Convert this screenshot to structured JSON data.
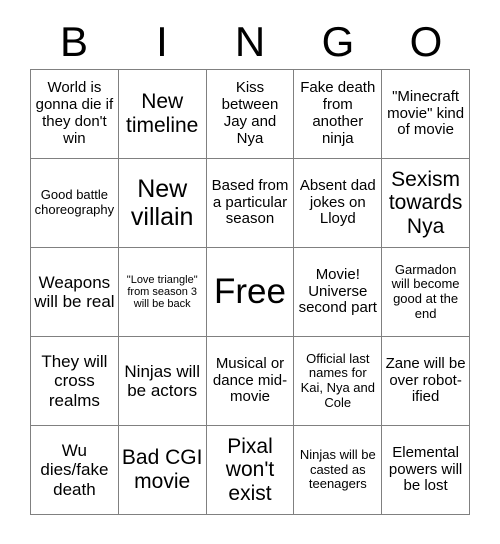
{
  "card": {
    "title": "BINGO",
    "header_letters": [
      "B",
      "I",
      "N",
      "G",
      "O"
    ],
    "columns": 5,
    "rows": 5,
    "colors": {
      "background": "#ffffff",
      "text": "#000000",
      "grid_line": "#808080"
    },
    "cells": [
      {
        "text": "World is gonna die if they don't win",
        "size": "md",
        "free": false
      },
      {
        "text": "New timeline",
        "size": "xl",
        "free": false
      },
      {
        "text": "Kiss between Jay and Nya",
        "size": "md",
        "free": false
      },
      {
        "text": "Fake death from another ninja",
        "size": "md",
        "free": false
      },
      {
        "text": "\"Minecraft movie\" kind of movie",
        "size": "md",
        "free": false
      },
      {
        "text": "Good battle choreography",
        "size": "sm",
        "free": false
      },
      {
        "text": "New villain",
        "size": "2xl",
        "free": false
      },
      {
        "text": "Based from a particular season",
        "size": "md",
        "free": false
      },
      {
        "text": "Absent dad jokes on Lloyd",
        "size": "md",
        "free": false
      },
      {
        "text": "Sexism towards Nya",
        "size": "xl",
        "free": false
      },
      {
        "text": "Weapons will be real",
        "size": "lg",
        "free": false
      },
      {
        "text": "\"Love triangle\" from season 3 will be back",
        "size": "xs",
        "free": false
      },
      {
        "text": "Free",
        "size": "3xl",
        "free": true
      },
      {
        "text": "Movie! Universe second part",
        "size": "md",
        "free": false
      },
      {
        "text": "Garmadon will become good at the end",
        "size": "sm",
        "free": false
      },
      {
        "text": "They will cross realms",
        "size": "lg",
        "free": false
      },
      {
        "text": "Ninjas will be actors",
        "size": "lg",
        "free": false
      },
      {
        "text": "Musical or dance mid-movie",
        "size": "md",
        "free": false
      },
      {
        "text": "Official last names for Kai, Nya and Cole",
        "size": "sm",
        "free": false
      },
      {
        "text": "Zane will be over robot-ified",
        "size": "md",
        "free": false
      },
      {
        "text": "Wu dies/fake death",
        "size": "lg",
        "free": false
      },
      {
        "text": "Bad CGI movie",
        "size": "xl",
        "free": false
      },
      {
        "text": "Pixal won't exist",
        "size": "xl",
        "free": false
      },
      {
        "text": "Ninjas will be casted as teenagers",
        "size": "sm",
        "free": false
      },
      {
        "text": "Elemental powers will be lost",
        "size": "md",
        "free": false
      }
    ]
  }
}
